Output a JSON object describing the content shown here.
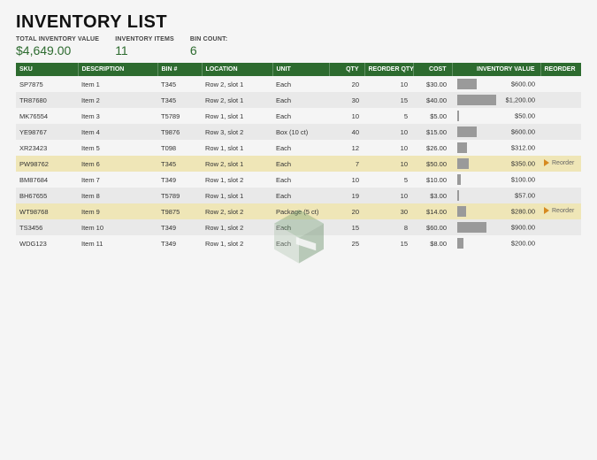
{
  "title": "INVENTORY LIST",
  "summary": {
    "totalLabel": "TOTAL INVENTORY VALUE",
    "totalValue": "$4,649.00",
    "itemsLabel": "INVENTORY ITEMS",
    "itemsValue": "11",
    "binLabel": "BIN COUNT:",
    "binValue": "6"
  },
  "columns": {
    "sku": "SKU",
    "desc": "DESCRIPTION",
    "bin": "BIN #",
    "loc": "LOCATION",
    "unit": "UNIT",
    "qty": "QTY",
    "reqty": "REORDER QTY",
    "cost": "COST",
    "inv": "INVENTORY VALUE",
    "re": "REORDER"
  },
  "chart_data": {
    "type": "table",
    "title": "Inventory List",
    "rows": [
      {
        "sku": "SP7875",
        "desc": "Item 1",
        "bin": "T345",
        "loc": "Row 2, slot 1",
        "unit": "Each",
        "qty": 20,
        "reqty": 10,
        "cost": "$30.00",
        "inv": "$600.00",
        "invNum": 600,
        "reorder": false
      },
      {
        "sku": "TR87680",
        "desc": "Item 2",
        "bin": "T345",
        "loc": "Row 2, slot 1",
        "unit": "Each",
        "qty": 30,
        "reqty": 15,
        "cost": "$40.00",
        "inv": "$1,200.00",
        "invNum": 1200,
        "reorder": false
      },
      {
        "sku": "MK76554",
        "desc": "Item 3",
        "bin": "T5789",
        "loc": "Row 1, slot 1",
        "unit": "Each",
        "qty": 10,
        "reqty": 5,
        "cost": "$5.00",
        "inv": "$50.00",
        "invNum": 50,
        "reorder": false
      },
      {
        "sku": "YE98767",
        "desc": "Item 4",
        "bin": "T9876",
        "loc": "Row 3, slot 2",
        "unit": "Box (10 ct)",
        "qty": 40,
        "reqty": 10,
        "cost": "$15.00",
        "inv": "$600.00",
        "invNum": 600,
        "reorder": false
      },
      {
        "sku": "XR23423",
        "desc": "Item 5",
        "bin": "T098",
        "loc": "Row 1, slot 1",
        "unit": "Each",
        "qty": 12,
        "reqty": 10,
        "cost": "$26.00",
        "inv": "$312.00",
        "invNum": 312,
        "reorder": false
      },
      {
        "sku": "PW98762",
        "desc": "Item 6",
        "bin": "T345",
        "loc": "Row 2, slot 1",
        "unit": "Each",
        "qty": 7,
        "reqty": 10,
        "cost": "$50.00",
        "inv": "$350.00",
        "invNum": 350,
        "reorder": true
      },
      {
        "sku": "BM87684",
        "desc": "Item 7",
        "bin": "T349",
        "loc": "Row 1, slot 2",
        "unit": "Each",
        "qty": 10,
        "reqty": 5,
        "cost": "$10.00",
        "inv": "$100.00",
        "invNum": 100,
        "reorder": false
      },
      {
        "sku": "BH67655",
        "desc": "Item 8",
        "bin": "T5789",
        "loc": "Row 1, slot 1",
        "unit": "Each",
        "qty": 19,
        "reqty": 10,
        "cost": "$3.00",
        "inv": "$57.00",
        "invNum": 57,
        "reorder": false
      },
      {
        "sku": "WT98768",
        "desc": "Item 9",
        "bin": "T9875",
        "loc": "Row 2, slot 2",
        "unit": "Package (5 ct)",
        "qty": 20,
        "reqty": 30,
        "cost": "$14.00",
        "inv": "$280.00",
        "invNum": 280,
        "reorder": true
      },
      {
        "sku": "TS3456",
        "desc": "Item 10",
        "bin": "T349",
        "loc": "Row 1, slot 2",
        "unit": "Each",
        "qty": 15,
        "reqty": 8,
        "cost": "$60.00",
        "inv": "$900.00",
        "invNum": 900,
        "reorder": false
      },
      {
        "sku": "WDG123",
        "desc": "Item 11",
        "bin": "T349",
        "loc": "Row 1, slot 2",
        "unit": "Each",
        "qty": 25,
        "reqty": 15,
        "cost": "$8.00",
        "inv": "$200.00",
        "invNum": 200,
        "reorder": false
      }
    ],
    "inv_max": 1200
  },
  "reorder_text": "Reorder"
}
